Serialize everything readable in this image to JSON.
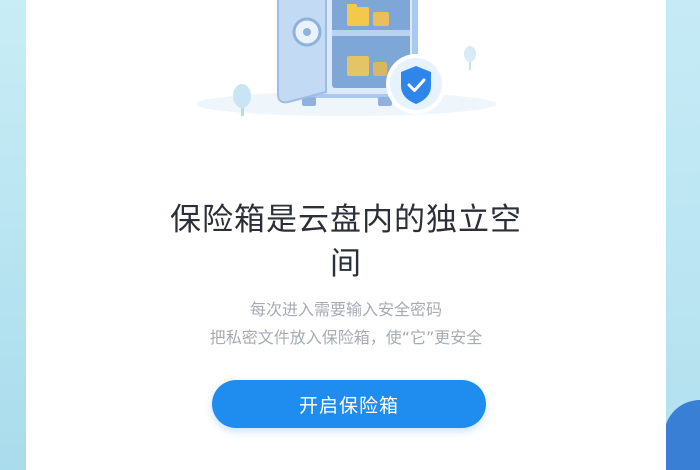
{
  "vault_intro": {
    "title_line1": "保险箱是云盘内的独立空",
    "title_line2": "间",
    "desc_line1": "每次进入需要输入安全密码",
    "desc_line2": "把私密文件放入保险箱，使“它”更安全",
    "open_button_label": "开启保险箱"
  },
  "colors": {
    "accent": "#1f8df0",
    "title_text": "#2a2f38",
    "desc_text": "#a6abb3",
    "side_background": "#bfe6f2"
  },
  "icons": [
    "safe-illustration",
    "shield-check-icon",
    "tree-icon",
    "folder-icon"
  ]
}
